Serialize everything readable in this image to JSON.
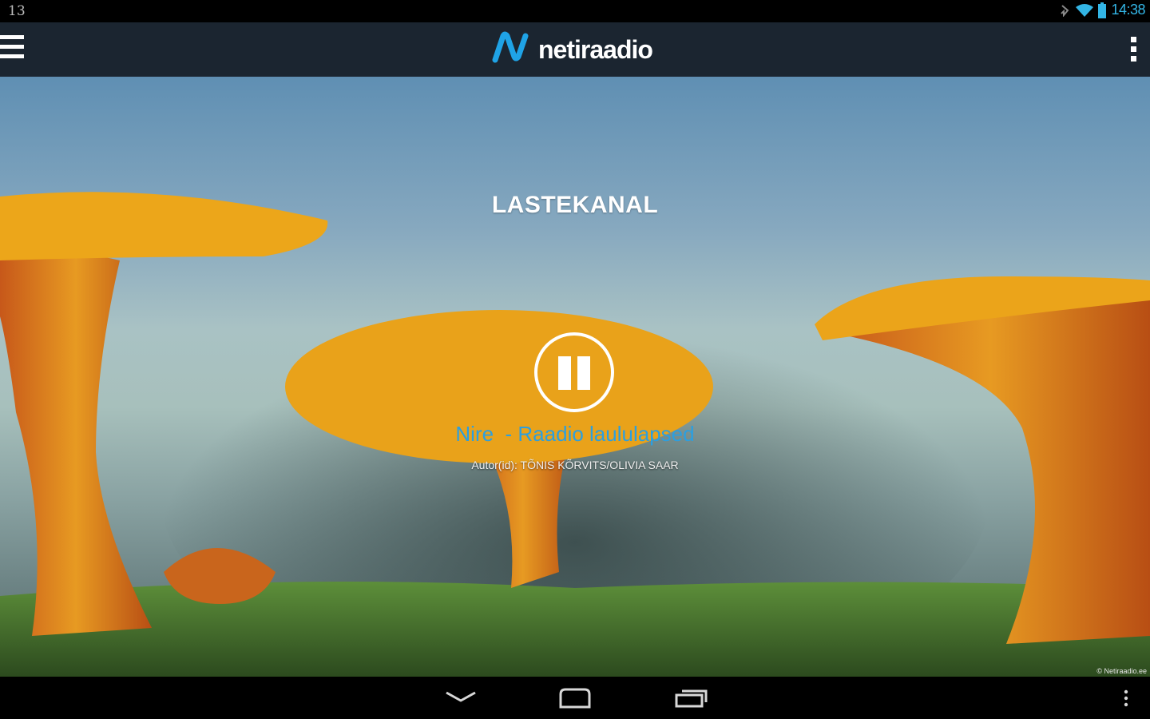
{
  "status_bar": {
    "left_text": "13",
    "time": "14:38",
    "icons": [
      "notification-icon",
      "wifi-icon",
      "battery-icon"
    ]
  },
  "app_bar": {
    "logo_text": "netiraadio",
    "icons": [
      "menu-icon",
      "logo-icon",
      "overflow-icon"
    ]
  },
  "player": {
    "channel_title": "LASTEKANAL",
    "track_title": "Nire  - Raadio laululapsed",
    "track_author": "Autor(id): TÕNIS KÕRVITS/OLIVIA SAAR",
    "state": "playing",
    "control_icon": "pause-icon"
  },
  "background": {
    "copyright": "© Netiraadio.ee"
  },
  "nav_bar": {
    "icons": [
      "back-icon",
      "home-icon",
      "recent-apps-icon",
      "overflow-icon"
    ]
  },
  "colors": {
    "accent": "#33b5e5",
    "track_title": "#2b9fe0",
    "app_bar": "#1b2530",
    "logo_mark": "#1fa3e6"
  }
}
